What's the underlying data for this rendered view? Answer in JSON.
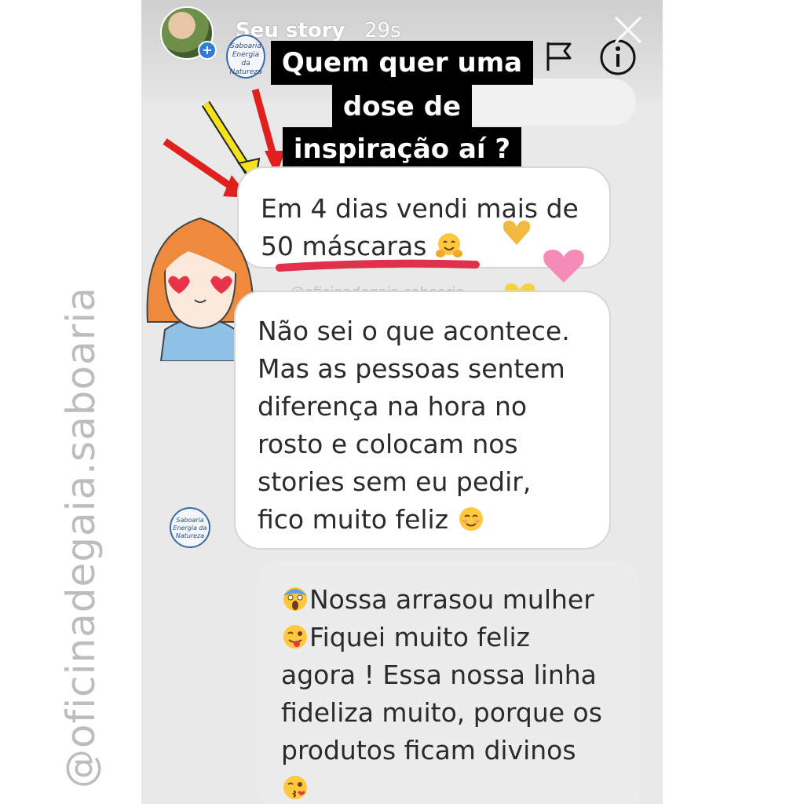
{
  "watermark": "@oficinadegaia.saboaria",
  "story": {
    "name": "Seu story",
    "time": "29s",
    "brand_logo_text": "Saboaria Energia da Natureza"
  },
  "caption": {
    "lines": [
      "Quem quer uma",
      "dose de",
      "inspiração aí ?"
    ]
  },
  "handle_tag": "@oficinadegaia.saboaria",
  "messages": {
    "m1": {
      "lines": [
        "Em 4 dias vendi mais de",
        "50 máscaras"
      ],
      "emoji": "hugging-face-emoji"
    },
    "m2": {
      "lines": [
        "Não sei o que acontece.",
        "Mas as pessoas sentem",
        "diferença na hora no",
        "rosto e colocam nos",
        "stories sem eu pedir,",
        "fico muito feliz"
      ],
      "emoji": "smiling-blush-emoji"
    },
    "m3": {
      "lines": [
        "Nossa arrasou mulher",
        "Fiquei muito feliz",
        "agora ! Essa nossa linha",
        "fideliza muito, porque os",
        "produtos ficam divinos"
      ],
      "emoji_start": "screaming-face-emoji",
      "emoji_second": "winking-tongue-emoji",
      "emoji_end": "kissing-face-emoji"
    }
  },
  "colors": {
    "arrow_red": "#e0201c",
    "arrow_yellow": "#f5e21c",
    "underline": "#e0304a",
    "heart_orange": "#f1b93f",
    "heart_pink": "#f58bb7"
  }
}
